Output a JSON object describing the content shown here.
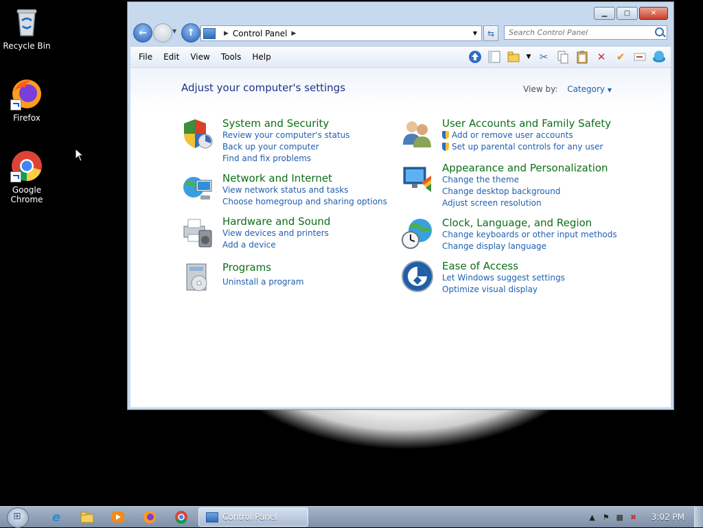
{
  "desktop": {
    "icons": [
      {
        "label": "Recycle Bin"
      },
      {
        "label": "Firefox"
      },
      {
        "label": "Google Chrome"
      }
    ]
  },
  "window": {
    "address": {
      "location": "Control Panel"
    },
    "search": {
      "placeholder": "Search Control Panel"
    },
    "menu": [
      "File",
      "Edit",
      "View",
      "Tools",
      "Help"
    ],
    "heading": "Adjust your computer's settings",
    "view_by": {
      "label": "View by:",
      "value": "Category"
    },
    "categories": [
      {
        "title": "System and Security",
        "links": [
          "Review your computer's status",
          "Back up your computer",
          "Find and fix problems"
        ]
      },
      {
        "title": "Network and Internet",
        "links": [
          "View network status and tasks",
          "Choose homegroup and sharing options"
        ]
      },
      {
        "title": "Hardware and Sound",
        "links": [
          "View devices and printers",
          "Add a device"
        ]
      },
      {
        "title": "Programs",
        "links": [
          "Uninstall a program"
        ]
      },
      {
        "title": "User Accounts and Family Safety",
        "links": [
          "Add or remove user accounts",
          "Set up parental controls for any user"
        ]
      },
      {
        "title": "Appearance and Personalization",
        "links": [
          "Change the theme",
          "Change desktop background",
          "Adjust screen resolution"
        ]
      },
      {
        "title": "Clock, Language, and Region",
        "links": [
          "Change keyboards or other input methods",
          "Change display language"
        ]
      },
      {
        "title": "Ease of Access",
        "links": [
          "Let Windows suggest settings",
          "Optimize visual display"
        ]
      }
    ]
  },
  "taskbar": {
    "task_label": "Control Panel",
    "clock": "3:02 PM"
  }
}
